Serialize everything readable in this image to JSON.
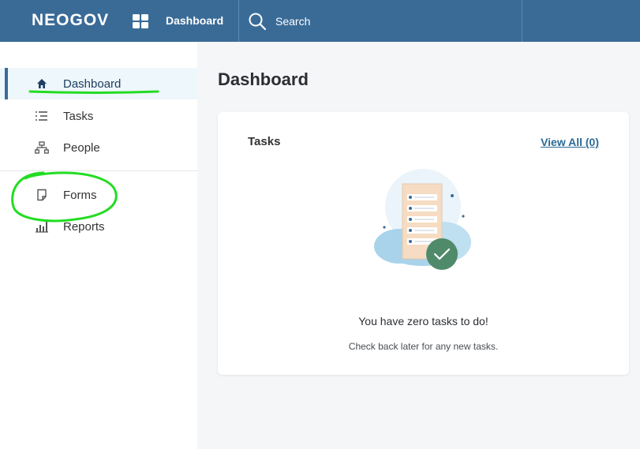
{
  "header": {
    "logo": "NEOGOV",
    "module": "Dashboard",
    "search_label": "Search"
  },
  "sidebar": {
    "items": [
      {
        "label": "Dashboard",
        "icon": "home-icon",
        "active": true
      },
      {
        "label": "Tasks",
        "icon": "tasks-list-icon",
        "active": false
      },
      {
        "label": "People",
        "icon": "org-chart-icon",
        "active": false
      },
      {
        "label": "Forms",
        "icon": "form-document-icon",
        "active": false
      },
      {
        "label": "Reports",
        "icon": "bar-chart-icon",
        "active": false
      }
    ]
  },
  "main": {
    "page_title": "Dashboard",
    "tasks_card": {
      "title": "Tasks",
      "view_all": "View All (0)",
      "empty_title": "You have zero tasks to do!",
      "empty_subtitle": "Check back later for any new tasks."
    }
  },
  "colors": {
    "topbar": "#3a6b97",
    "accent": "#3a6b97",
    "active_bg": "#eef7fb",
    "annotation_green": "#22dd22",
    "check_circle": "#4f8a6b"
  }
}
